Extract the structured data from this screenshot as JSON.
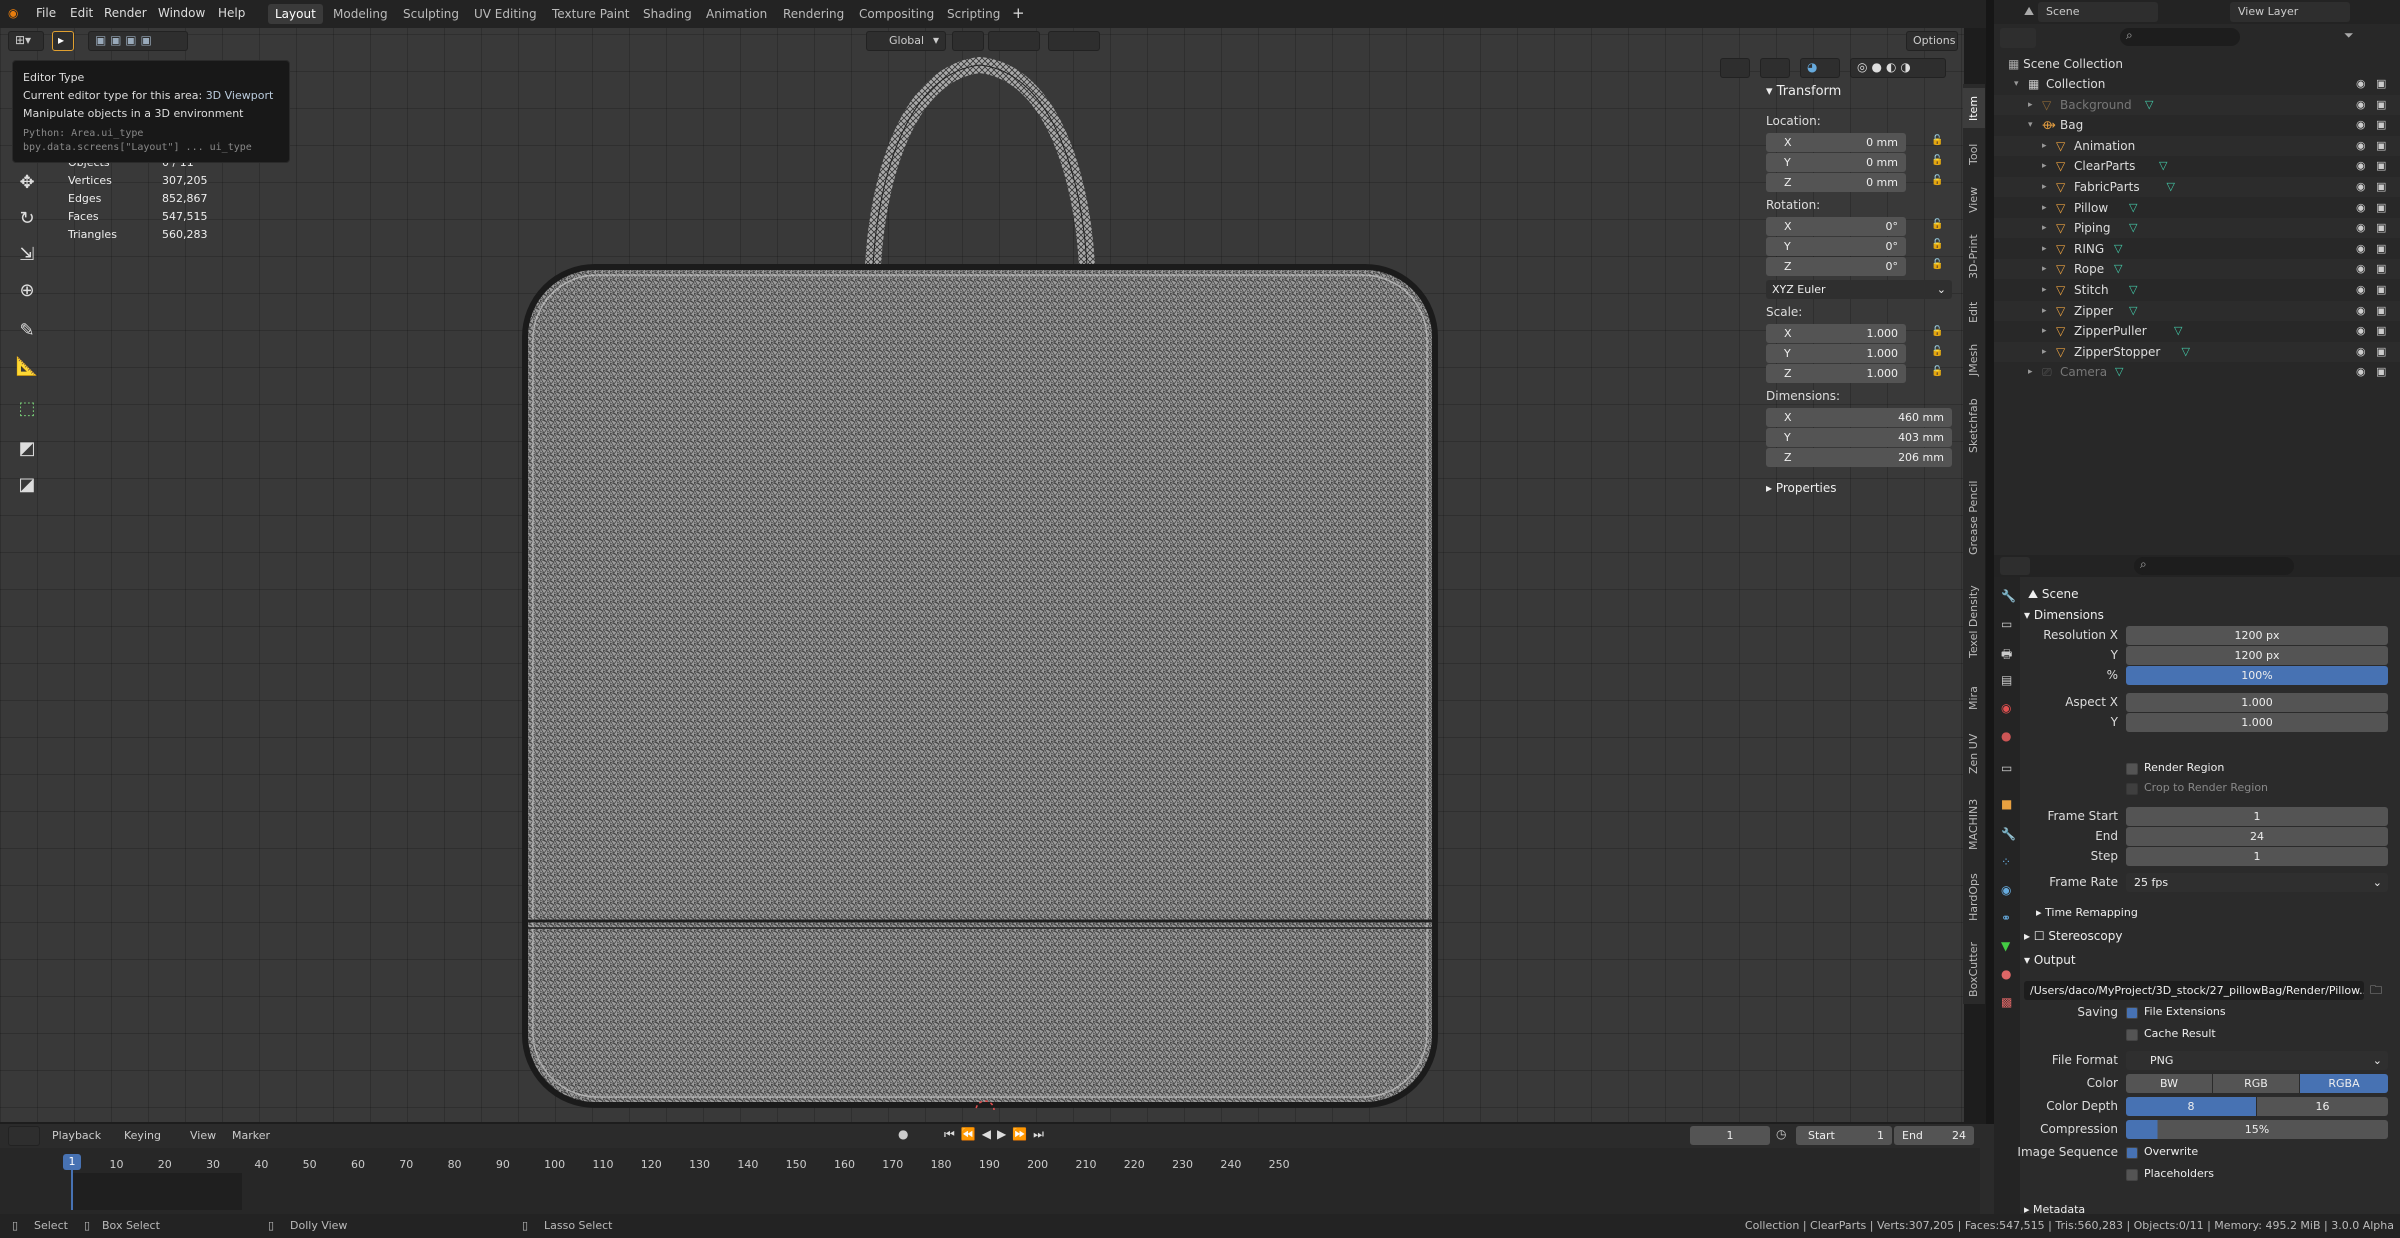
{
  "menu": [
    "File",
    "Edit",
    "Render",
    "Window",
    "Help"
  ],
  "workspaces": [
    "Layout",
    "Modeling",
    "Sculpting",
    "UV Editing",
    "Texture Paint",
    "Shading",
    "Animation",
    "Rendering",
    "Compositing",
    "Scripting"
  ],
  "viewport_header": {
    "orientation": "Global",
    "options": "Options"
  },
  "tooltip": {
    "title": "Editor Type",
    "line1_label": "Current editor type for this area:",
    "line1_value": "3D Viewport",
    "line2": "Manipulate objects in a 3D environment",
    "py1": "Python: Area.ui_type",
    "py2": "bpy.data.screens[\"Layout\"] ... ui_type"
  },
  "stats": [
    {
      "k": "Objects",
      "v": "0 / 11"
    },
    {
      "k": "Vertices",
      "v": "307,205"
    },
    {
      "k": "Edges",
      "v": "852,867"
    },
    {
      "k": "Faces",
      "v": "547,515"
    },
    {
      "k": "Triangles",
      "v": "560,283"
    }
  ],
  "npanel": {
    "transform": "Transform",
    "location": "Location:",
    "rotation": "Rotation:",
    "scale": "Scale:",
    "dimensions": "Dimensions:",
    "euler": "XYZ Euler",
    "properties": "Properties",
    "loc": [
      {
        "a": "X",
        "v": "0 mm"
      },
      {
        "a": "Y",
        "v": "0 mm"
      },
      {
        "a": "Z",
        "v": "0 mm"
      }
    ],
    "rot": [
      {
        "a": "X",
        "v": "0°"
      },
      {
        "a": "Y",
        "v": "0°"
      },
      {
        "a": "Z",
        "v": "0°"
      }
    ],
    "scl": [
      {
        "a": "X",
        "v": "1.000"
      },
      {
        "a": "Y",
        "v": "1.000"
      },
      {
        "a": "Z",
        "v": "1.000"
      }
    ],
    "dim": [
      {
        "a": "X",
        "v": "460 mm"
      },
      {
        "a": "Y",
        "v": "403 mm"
      },
      {
        "a": "Z",
        "v": "206 mm"
      }
    ]
  },
  "vtabs": [
    "Item",
    "Tool",
    "View",
    "3D-Print",
    "Edit",
    "JMesh",
    "Sketchfab",
    "Grease Pencil",
    "Texel Density",
    "Mira",
    "Zen UV",
    "MACHIN3",
    "HardOps",
    "BoxCutter"
  ],
  "outliner": {
    "scene": "Scene",
    "view_layer": "View Layer",
    "scene_collection": "Scene Collection",
    "rows": [
      {
        "name": "Collection",
        "indent": 1
      },
      {
        "name": "Background",
        "indent": 2,
        "dim": true
      },
      {
        "name": "Bag",
        "indent": 2
      },
      {
        "name": "Animation",
        "indent": 3
      },
      {
        "name": "ClearParts",
        "indent": 3
      },
      {
        "name": "FabricParts",
        "indent": 3
      },
      {
        "name": "Pillow",
        "indent": 3
      },
      {
        "name": "Piping",
        "indent": 3
      },
      {
        "name": "RING",
        "indent": 3
      },
      {
        "name": "Rope",
        "indent": 3
      },
      {
        "name": "Stitch",
        "indent": 3
      },
      {
        "name": "Zipper",
        "indent": 3
      },
      {
        "name": "ZipperPuller",
        "indent": 3
      },
      {
        "name": "ZipperStopper",
        "indent": 3
      },
      {
        "name": "Camera",
        "indent": 2,
        "dim": true
      }
    ]
  },
  "props": {
    "scene": "Scene",
    "dimensions": "Dimensions",
    "res_x_label": "Resolution X",
    "res_x": "1200 px",
    "res_y_label": "Y",
    "res_y": "1200 px",
    "pct_label": "%",
    "pct": "100%",
    "aspect_x_label": "Aspect X",
    "aspect_x": "1.000",
    "aspect_y_label": "Y",
    "aspect_y": "1.000",
    "render_region": "Render Region",
    "crop": "Crop to Render Region",
    "frame_start_label": "Frame Start",
    "frame_start": "1",
    "end_label": "End",
    "end": "24",
    "step_label": "Step",
    "step": "1",
    "frame_rate_label": "Frame Rate",
    "frame_rate": "25 fps",
    "time_remap": "Time Remapping",
    "stereo": "Stereoscopy",
    "output": "Output",
    "path": "/Users/daco/MyProject/3D_stock/27_pillowBag/Render/Pillow...",
    "saving_label": "Saving",
    "file_ext": "File Extensions",
    "cache": "Cache Result",
    "format_label": "File Format",
    "format": "PNG",
    "color_label": "Color",
    "bw": "BW",
    "rgb": "RGB",
    "rgba": "RGBA",
    "depth_label": "Color Depth",
    "d8": "8",
    "d16": "16",
    "compression_label": "Compression",
    "compression": "15%",
    "seq_label": "Image Sequence",
    "overwrite": "Overwrite",
    "placeholders": "Placeholders",
    "metadata": "Metadata"
  },
  "timeline": {
    "menus": [
      "Playback",
      "Keying",
      "View",
      "Marker"
    ],
    "current": "1",
    "start_label": "Start",
    "start": "1",
    "end_label": "End",
    "end": "24",
    "ticks": [
      "1",
      "10",
      "20",
      "30",
      "40",
      "50",
      "60",
      "70",
      "80",
      "90",
      "100",
      "110",
      "120",
      "130",
      "140",
      "150",
      "160",
      "170",
      "180",
      "190",
      "200",
      "210",
      "220",
      "230",
      "240",
      "250"
    ]
  },
  "status": {
    "select": "Select",
    "box": "Box Select",
    "dolly": "Dolly View",
    "lasso": "Lasso Select",
    "info": "Collection | ClearParts | Verts:307,205 | Faces:547,515 | Tris:560,283 | Objects:0/11 | Memory: 495.2 MiB | 3.0.0 Alpha"
  }
}
